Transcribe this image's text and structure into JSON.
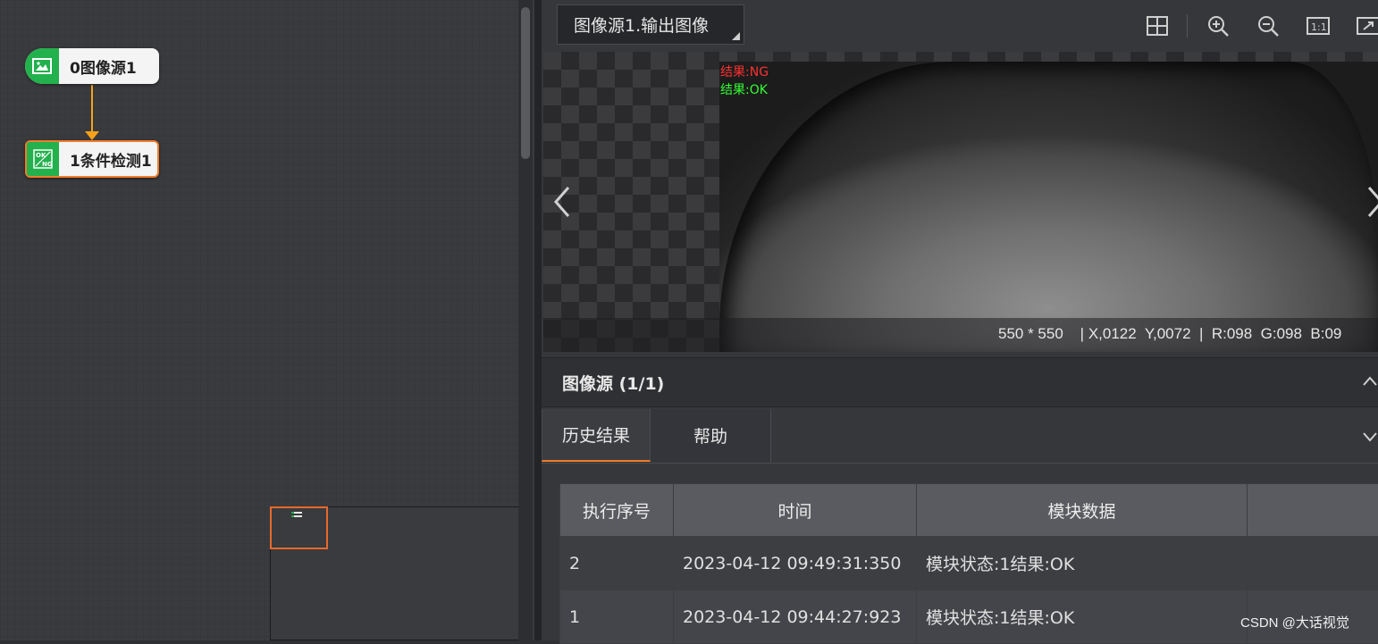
{
  "flow": {
    "nodes": [
      {
        "label": "0图像源1",
        "icon": "image-icon"
      },
      {
        "label": "1条件检测1",
        "icon": "ok-ng-icon"
      }
    ]
  },
  "viewer": {
    "source_select": "图像源1.输出图像",
    "overlay_ng": "结果:NG",
    "overlay_ok": "结果:OK",
    "status": "550 * 550    | X,0122  Y,0072  |  R:098  G:098  B:09",
    "toolbar_icons": [
      "crosshair-icon",
      "zoom-in-icon",
      "zoom-out-icon",
      "actual-size-icon",
      "fit-screen-icon"
    ]
  },
  "panel": {
    "title": "图像源 (1/1)",
    "tabs": [
      "历史结果",
      "帮助"
    ],
    "table": {
      "headers": [
        "执行序号",
        "时间",
        "模块数据",
        ""
      ],
      "rows": [
        [
          "2",
          "2023-04-12 09:49:31:350",
          "模块状态:1结果:OK",
          ""
        ],
        [
          "1",
          "2023-04-12 09:44:27:923",
          "模块状态:1结果:OK",
          ""
        ]
      ]
    }
  },
  "watermark": "CSDN @大话视觉",
  "colors": {
    "accent": "#f07c2a",
    "node_green": "#23b14d",
    "connector": "#f5a21a",
    "ng": "#ff3030",
    "ok": "#33ff33"
  }
}
